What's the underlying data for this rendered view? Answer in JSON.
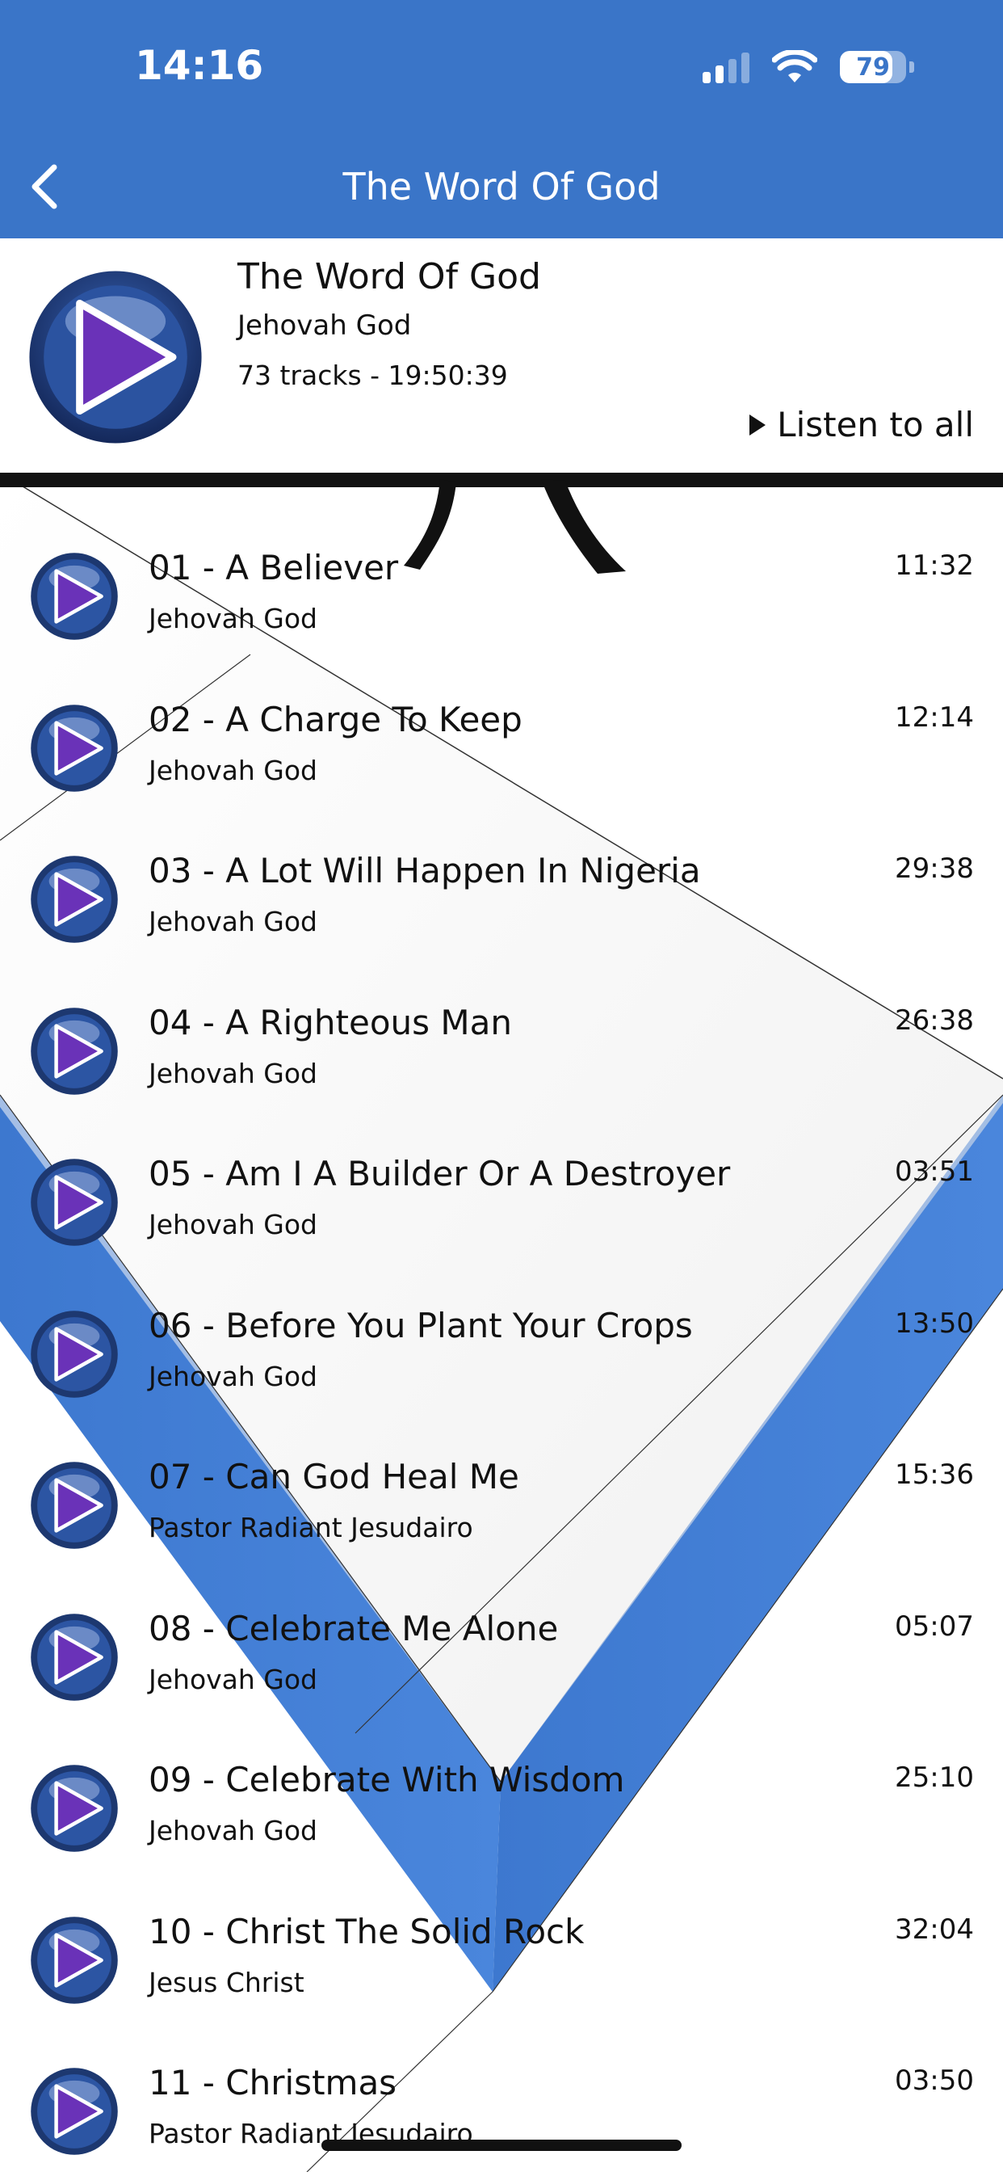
{
  "status": {
    "time": "14:16",
    "battery": "79",
    "battery_level": 0.79
  },
  "nav": {
    "title": "The Word Of God"
  },
  "album": {
    "title": "The Word Of God",
    "artist": "Jehovah God",
    "meta": "73 tracks - 19:50:39",
    "listen_all": "Listen to all"
  },
  "colors": {
    "header": "#3a75c8",
    "play_button": "#6a32b8",
    "play_ring": "#233f78"
  },
  "tracks": [
    {
      "title": "01 - A Believer",
      "artist": "Jehovah God",
      "duration": "11:32"
    },
    {
      "title": "02 - A Charge To Keep",
      "artist": "Jehovah God",
      "duration": "12:14"
    },
    {
      "title": "03 - A Lot Will Happen In Nigeria",
      "artist": "Jehovah God",
      "duration": "29:38"
    },
    {
      "title": "04 - A Righteous Man",
      "artist": "Jehovah God",
      "duration": "26:38"
    },
    {
      "title": "05 - Am I A Builder Or A Destroyer",
      "artist": "Jehovah God",
      "duration": "03:51"
    },
    {
      "title": "06 - Before You Plant Your Crops",
      "artist": "Jehovah God",
      "duration": "13:50"
    },
    {
      "title": "07 - Can God Heal Me",
      "artist": "Pastor Radiant Jesudairo",
      "duration": "15:36"
    },
    {
      "title": "08 - Celebrate Me Alone",
      "artist": "Jehovah God",
      "duration": "05:07"
    },
    {
      "title": "09 - Celebrate With Wisdom",
      "artist": "Jehovah God",
      "duration": "25:10"
    },
    {
      "title": "10 - Christ The Solid Rock",
      "artist": "Jesus Christ",
      "duration": "32:04"
    },
    {
      "title": "11 - Christmas",
      "artist": "Pastor Radiant Jesudairo",
      "duration": "03:50"
    }
  ]
}
